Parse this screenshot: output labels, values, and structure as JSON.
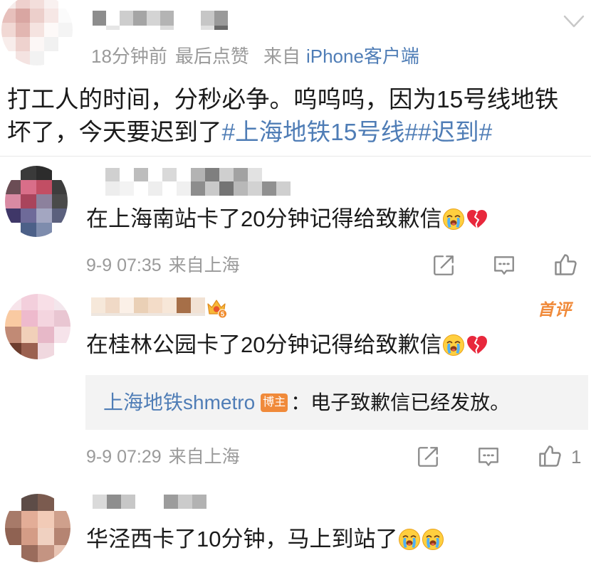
{
  "colors": {
    "text": "#1a1a1a",
    "meta_gray": "#9a9a9a",
    "link_blue": "#4f7db6",
    "icon_gray": "#8c8c8c",
    "accent_orange": "#f08a3a",
    "divider": "#e8e8e8",
    "reply_bg": "#f3f3f3"
  },
  "post": {
    "meta": {
      "time": "18分钟前",
      "last_like": "最后点赞",
      "source_prefix": "来自",
      "source": "iPhone客户端"
    },
    "text": "打工人的时间，分秒必争。呜呜呜，因为15号线地铁坏了，今天要迟到了",
    "hashtags": [
      "#上海地铁15号线#",
      "#迟到#"
    ]
  },
  "comments": [
    {
      "text": "在上海南站卡了20分钟记得给致歉信",
      "emoji": [
        "crying-face-icon",
        "broken-heart-icon"
      ],
      "time": "9-9 07:35",
      "location": "来自上海"
    },
    {
      "level_badge": "5",
      "first_comment_tag": "首评",
      "text": "在桂林公园卡了20分钟记得给致歉信",
      "emoji": [
        "crying-face-icon",
        "broken-heart-icon"
      ],
      "reply": {
        "author": "上海地铁shmetro",
        "author_badge": "博主",
        "text": "：电子致歉信已经发放。"
      },
      "time": "9-9 07:29",
      "location": "来自上海",
      "like_count": "1"
    },
    {
      "text": "华泾西卡了10分钟，马上到站了",
      "emoji": [
        "crying-face-icon",
        "crying-face-icon"
      ]
    }
  ]
}
